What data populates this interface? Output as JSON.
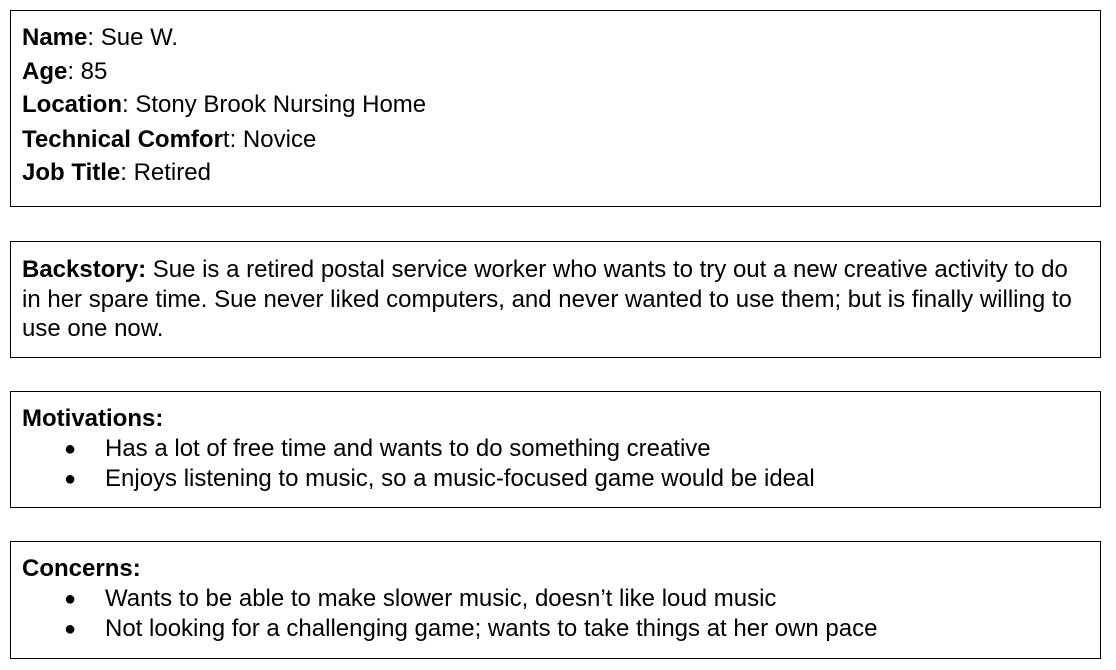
{
  "profile": {
    "name_label": "Name",
    "name_value": ": Sue W.",
    "age_label": "Age",
    "age_value": ": 85",
    "location_label": "Location",
    "location_value": ": Stony Brook Nursing Home",
    "tech_label": "Technical Comfor",
    "tech_value": "t: Novice",
    "job_label": "Job Title",
    "job_value": ": Retired"
  },
  "backstory": {
    "label": "Backstory:",
    "text": " Sue is a retired postal service worker who wants to try out a new creative activity to do in her spare time. Sue never liked computers, and never wanted to use them; but is finally willing to use one now."
  },
  "motivations": {
    "label": "Motivations:",
    "items": [
      "Has a lot of free time and wants to do something creative",
      "Enjoys listening to music, so a music-focused game would be ideal"
    ]
  },
  "concerns": {
    "label": "Concerns:",
    "items": [
      "Wants to be able to make slower music, doesn’t like loud music",
      "Not looking for a challenging game; wants to take things at her own pace"
    ]
  },
  "bullet_glyph": "●"
}
